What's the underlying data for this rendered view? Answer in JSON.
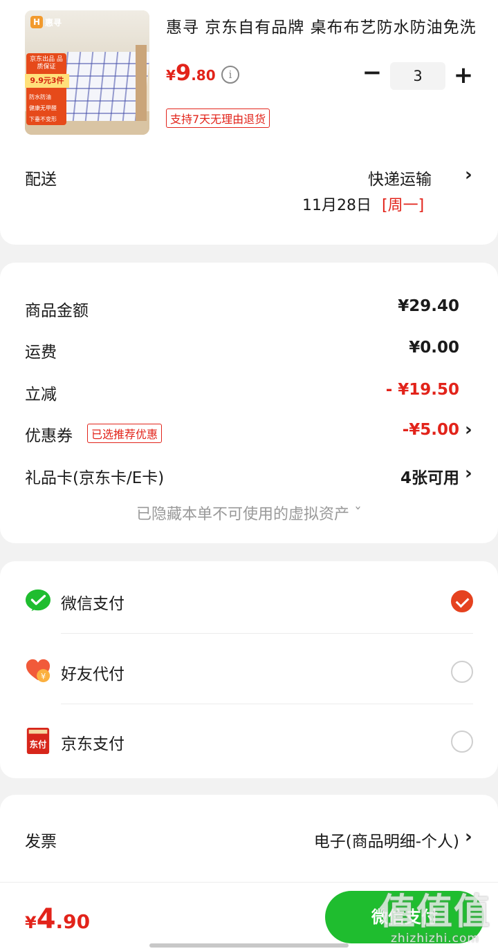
{
  "product": {
    "thumb_brand": "惠寻",
    "thumb_promo_title": "京东出品 品质保证",
    "thumb_promo_price": "9.9元3件",
    "thumb_features": [
      "防水防油",
      "健康无甲醛",
      "下垂不变形"
    ],
    "title": "惠寻  京东自有品牌  桌布布艺防水防油免洗",
    "price_symbol": "¥",
    "price_int": "9",
    "price_dec": ".80",
    "quantity": "3",
    "return_policy": "支持7天无理由退货"
  },
  "delivery": {
    "label": "配送",
    "method": "快递运输",
    "date": "11月28日",
    "weekday": "[周一]"
  },
  "summary": {
    "goods_label": "商品金额",
    "goods_value": "¥29.40",
    "shipping_label": "运费",
    "shipping_value": "¥0.00",
    "discount_label": "立减",
    "discount_value": "- ¥19.50",
    "coupon_label": "优惠券",
    "coupon_badge": "已选推荐优惠",
    "coupon_value": "-¥5.00",
    "giftcard_label": "礼品卡(京东卡/E卡)",
    "giftcard_value": "4张可用",
    "hidden_assets": "已隐藏本单不可使用的虚拟资产 ˇ"
  },
  "payment": {
    "wechat": "微信支付",
    "friend": "好友代付",
    "jd": "京东支付",
    "jd_icon_text": "东付",
    "selected": "wechat"
  },
  "invoice": {
    "label": "发票",
    "value": "电子(商品明细-个人)"
  },
  "footer": {
    "total_symbol": "¥",
    "total_int": "4",
    "total_dec": ".90",
    "pay_button": "微信支付"
  },
  "watermark": {
    "big": "值值值",
    "url": "zhizhizhi.com"
  },
  "colors": {
    "accent_red": "#e2231a",
    "wechat_green": "#1fbd2f",
    "radio_checked": "#e5421f"
  }
}
